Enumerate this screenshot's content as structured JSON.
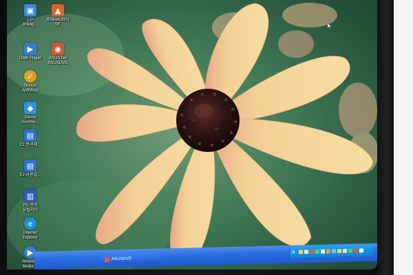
{
  "desktop": {
    "icons": [
      {
        "label": "LG\nIntelig...",
        "icon": "lg-app-icon",
        "color": "#3a8ad8"
      },
      {
        "label": "3DMark2001\nSE",
        "icon": "3dmark-icon",
        "color": "#d8652a"
      },
      {
        "label": "DMB Player",
        "icon": "dmb-player-icon",
        "color": "#3a7dd0"
      },
      {
        "label": "ASUSTek\nASUSDVD",
        "icon": "asusdvd-icon",
        "color": "#c85a3a"
      },
      {
        "label": "Norton\nAntiVirus",
        "icon": "norton-icon",
        "color": "#e0a020"
      },
      {
        "label": "Xteme\nSumme...",
        "icon": "xteme-icon",
        "color": "#2f93d8"
      },
      {
        "label": "Ez 문서재...",
        "icon": "ez-doc-icon",
        "color": "#2f6fd0"
      },
      {
        "label": "Ez 사용설...",
        "icon": "ez-manual-icon",
        "color": "#2f6fd0"
      },
      {
        "label": "PC 관리\n유틸리티",
        "icon": "pc-util-icon",
        "color": "#2b5fbf"
      },
      {
        "label": "Internet\nExplorer",
        "icon": "internet-explorer-icon",
        "color": "#1f8fe0"
      },
      {
        "label": "Windows\nMedia ...",
        "icon": "windows-media-icon",
        "color": "#3a7dd0"
      }
    ]
  },
  "taskbar": {
    "window_button_label": "ASUSDVD",
    "tray_language": "A"
  },
  "colors": {
    "taskbar": "#2a6fe0",
    "tray": "#1282d8",
    "petal": "#f2d08a",
    "flower_center": "#2a1214"
  }
}
